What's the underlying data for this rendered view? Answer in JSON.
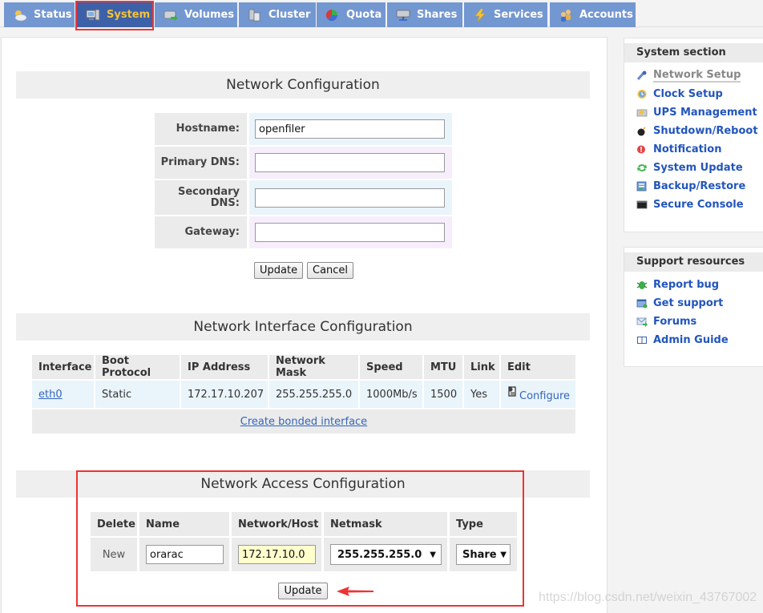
{
  "tabs": [
    {
      "label": "Status",
      "icon": "weather-sun-cloud-icon",
      "active": false
    },
    {
      "label": "System",
      "icon": "computer-icon",
      "active": true
    },
    {
      "label": "Volumes",
      "icon": "drive-icon",
      "active": false
    },
    {
      "label": "Cluster",
      "icon": "cluster-servers-icon",
      "active": false
    },
    {
      "label": "Quota",
      "icon": "pie-quota-icon",
      "active": false
    },
    {
      "label": "Shares",
      "icon": "network-share-icon",
      "active": false
    },
    {
      "label": "Services",
      "icon": "lightning-icon",
      "active": false
    },
    {
      "label": "Accounts",
      "icon": "users-icon",
      "active": false
    }
  ],
  "network_config": {
    "title": "Network Configuration",
    "fields": [
      {
        "label": "Hostname:",
        "value": "openfiler"
      },
      {
        "label": "Primary DNS:",
        "value": ""
      },
      {
        "label": "Secondary DNS:",
        "value": ""
      },
      {
        "label": "Gateway:",
        "value": ""
      }
    ],
    "update_label": "Update",
    "cancel_label": "Cancel"
  },
  "interface_config": {
    "title": "Network Interface Configuration",
    "columns": [
      "Interface",
      "Boot Protocol",
      "IP Address",
      "Network Mask",
      "Speed",
      "MTU",
      "Link",
      "Edit"
    ],
    "rows": [
      {
        "interface": "eth0",
        "boot_protocol": "Static",
        "ip": "172.17.10.207",
        "mask": "255.255.255.0",
        "speed": "1000Mb/s",
        "mtu": "1500",
        "link": "Yes",
        "edit": "Configure"
      }
    ],
    "bond_link": "Create bonded interface"
  },
  "access_config": {
    "title": "Network Access Configuration",
    "columns": [
      "Delete",
      "Name",
      "Network/Host",
      "Netmask",
      "Type"
    ],
    "new_row": {
      "delete": "New",
      "name": "orarac",
      "network": "172.17.10.0",
      "netmask": "255.255.255.0",
      "type": "Share"
    },
    "update_label": "Update"
  },
  "sidebar": {
    "system_section": {
      "title": "System section",
      "items": [
        {
          "label": "Network Setup",
          "icon": "network-setup-icon",
          "current": true
        },
        {
          "label": "Clock Setup",
          "icon": "clock-icon"
        },
        {
          "label": "UPS Management",
          "icon": "ups-icon"
        },
        {
          "label": "Shutdown/Reboot",
          "icon": "bomb-icon"
        },
        {
          "label": "Notification",
          "icon": "alert-icon"
        },
        {
          "label": "System Update",
          "icon": "refresh-icon"
        },
        {
          "label": "Backup/Restore",
          "icon": "backup-icon"
        },
        {
          "label": "Secure Console",
          "icon": "console-icon"
        }
      ]
    },
    "support": {
      "title": "Support resources",
      "items": [
        {
          "label": "Report bug",
          "icon": "bug-icon"
        },
        {
          "label": "Get support",
          "icon": "support-icon"
        },
        {
          "label": "Forums",
          "icon": "mail-forum-icon"
        },
        {
          "label": "Admin Guide",
          "icon": "book-icon"
        }
      ]
    }
  },
  "watermark": "https://blog.csdn.net/weixin_43767002",
  "colors": {
    "tab": "#7397d1",
    "tab_active": "#3d61a8",
    "tab_active_text": "#f2c23d",
    "link": "#2255bb",
    "highlight": "#ee3333"
  }
}
